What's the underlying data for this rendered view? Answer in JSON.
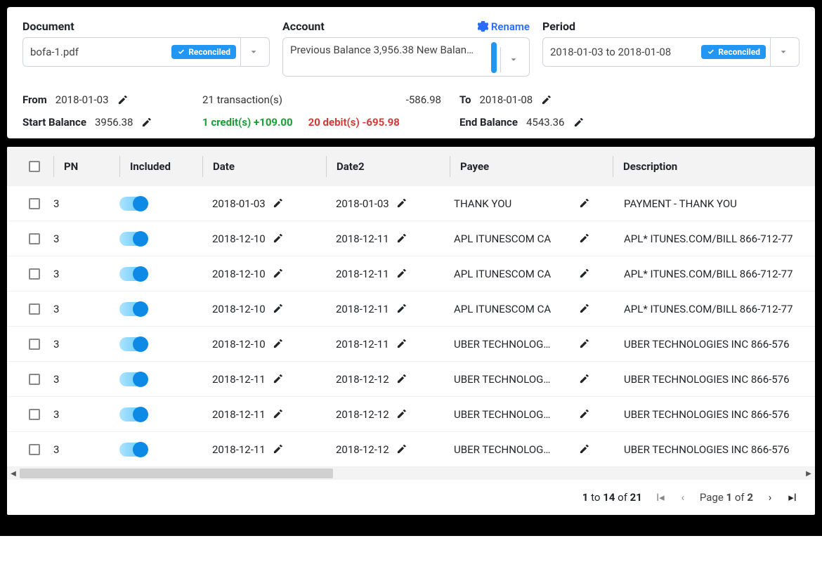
{
  "header": {
    "document": {
      "label": "Document",
      "value": "bofa-1.pdf",
      "badge": "Reconciled"
    },
    "account": {
      "label": "Account",
      "rename": "Rename",
      "value": "Previous Balance 3,956.38 New Balan…"
    },
    "period": {
      "label": "Period",
      "value": "2018-01-03 to 2018-01-08",
      "badge": "Reconciled"
    }
  },
  "summary": {
    "from_label": "From",
    "from": "2018-01-03",
    "to_label": "To",
    "to": "2018-01-08",
    "start_label": "Start Balance",
    "start": "3956.38",
    "end_label": "End Balance",
    "end": "4543.36",
    "txn_count": "21 transaction(s)",
    "net": "-586.98",
    "credits": "1 credit(s) +109.00",
    "debits": "20 debit(s) -695.98"
  },
  "columns": {
    "pn": "PN",
    "included": "Included",
    "date": "Date",
    "date2": "Date2",
    "payee": "Payee",
    "description": "Description"
  },
  "rows": [
    {
      "pn": "3",
      "date": "2018-01-03",
      "date2": "2018-01-03",
      "payee": "THANK YOU",
      "desc": "PAYMENT - THANK YOU"
    },
    {
      "pn": "3",
      "date": "2018-12-10",
      "date2": "2018-12-11",
      "payee": "APL ITUNESCOM CA",
      "desc": "APL* ITUNES.COM/BILL 866-712-77"
    },
    {
      "pn": "3",
      "date": "2018-12-10",
      "date2": "2018-12-11",
      "payee": "APL ITUNESCOM CA",
      "desc": "APL* ITUNES.COM/BILL 866-712-77"
    },
    {
      "pn": "3",
      "date": "2018-12-10",
      "date2": "2018-12-11",
      "payee": "APL ITUNESCOM CA",
      "desc": "APL* ITUNES.COM/BILL 866-712-77"
    },
    {
      "pn": "3",
      "date": "2018-12-10",
      "date2": "2018-12-11",
      "payee": "UBER TECHNOLOG…",
      "desc": "UBER TECHNOLOGIES INC 866-576"
    },
    {
      "pn": "3",
      "date": "2018-12-11",
      "date2": "2018-12-12",
      "payee": "UBER TECHNOLOG…",
      "desc": "UBER TECHNOLOGIES INC 866-576"
    },
    {
      "pn": "3",
      "date": "2018-12-11",
      "date2": "2018-12-12",
      "payee": "UBER TECHNOLOG…",
      "desc": "UBER TECHNOLOGIES INC 866-576"
    },
    {
      "pn": "3",
      "date": "2018-12-11",
      "date2": "2018-12-12",
      "payee": "UBER TECHNOLOG…",
      "desc": "UBER TECHNOLOGIES INC 866-576"
    }
  ],
  "pager": {
    "range_from": "1",
    "range_to": "14",
    "total": "21",
    "page_label": "Page",
    "page": "1",
    "pages": "2",
    "to_word": "to",
    "of_word": "of"
  }
}
